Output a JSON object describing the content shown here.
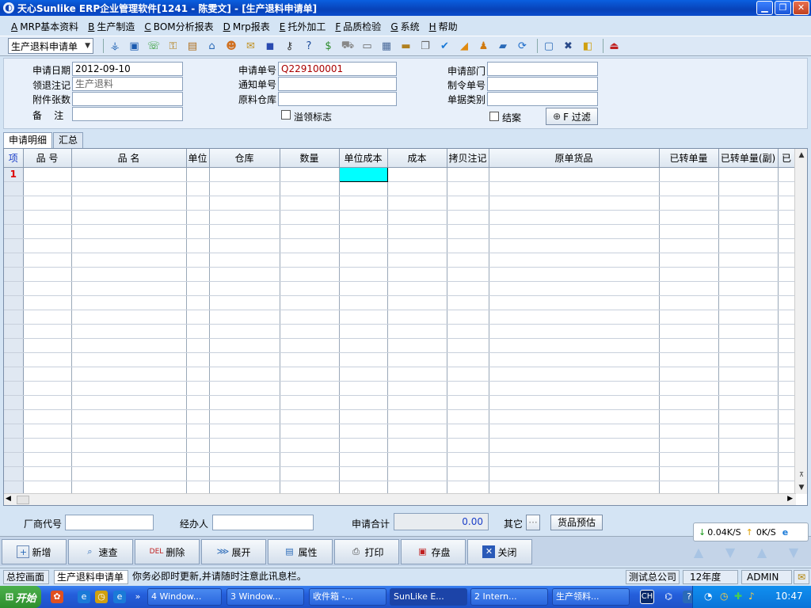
{
  "window": {
    "title": "天心Sunlike ERP企业管理软件[1241 - 陈雯文] - [生产退料申请单]"
  },
  "menu": [
    {
      "key": "A",
      "label": "MRP基本资料"
    },
    {
      "key": "B",
      "label": "生产制造"
    },
    {
      "key": "C",
      "label": "BOM分析报表"
    },
    {
      "key": "D",
      "label": "Mrp报表"
    },
    {
      "key": "E",
      "label": "托外加工"
    },
    {
      "key": "F",
      "label": "品质检验"
    },
    {
      "key": "G",
      "label": "系统"
    },
    {
      "key": "H",
      "label": "帮助"
    }
  ],
  "toolbar": {
    "doc_select": "生产退料申请单"
  },
  "form": {
    "apply_date_label": "申请日期",
    "apply_date": "2012-09-10",
    "return_note_label": "领退注记",
    "return_note": "生产退料",
    "attach_label": "附件张数",
    "attach": "",
    "remark_label": "备    注",
    "remark": "",
    "apply_no_label": "申请单号",
    "apply_no": "Q229100001",
    "notice_no_label": "通知单号",
    "notice_no": "",
    "warehouse_label": "原料仓库",
    "warehouse": "",
    "overflow_label": "溢领标志",
    "dept_label": "申请部门",
    "dept": "",
    "order_no_label": "制令单号",
    "order_no": "",
    "doc_type_label": "单据类别",
    "doc_type": "",
    "closed_label": "结案",
    "filter_btn": "F 过滤"
  },
  "tabs": [
    "申请明细",
    "汇总"
  ],
  "grid": {
    "columns": [
      "项",
      "品  号",
      "品  名",
      "单位",
      "仓库",
      "数量",
      "单位成本",
      "成本",
      "拷贝注记",
      "原单货品",
      "已转单量",
      "已转单量(副)",
      "已"
    ],
    "first_row_index": "1"
  },
  "footer": {
    "vendor_label": "厂商代号",
    "vendor": "",
    "handler_label": "经办人",
    "handler": "",
    "total_label": "申请合计",
    "total": "0.00",
    "other_label": "其它",
    "other_btn": "···",
    "estimate_btn": "货品预估"
  },
  "net": {
    "down": "0.04K/S",
    "up": "0K/S"
  },
  "actions": [
    "新增",
    "速查",
    "删除",
    "展开",
    "属性",
    "打印",
    "存盘",
    "关闭"
  ],
  "action_icon_text": {
    "delete": "DEL"
  },
  "status": {
    "tab1": "总控画面",
    "tab2": "生产退料申请单",
    "message": "你务必即时更新,并请随时注意此讯息栏。",
    "company": "测试总公司",
    "year": "12年度",
    "user": "ADMIN"
  },
  "taskbar": {
    "start": "开始",
    "tasks": [
      "4 Window...",
      "3 Window...",
      "收件箱 -...",
      "SunLike E...",
      "2 Intern...",
      "生产领料..."
    ],
    "lang": "CH",
    "time": "10:47"
  },
  "colors": {
    "accent": "#0a5fe0",
    "selected_cell": "#00ffff",
    "row_index": "#dd0000",
    "amount": "#1a3ec8"
  }
}
